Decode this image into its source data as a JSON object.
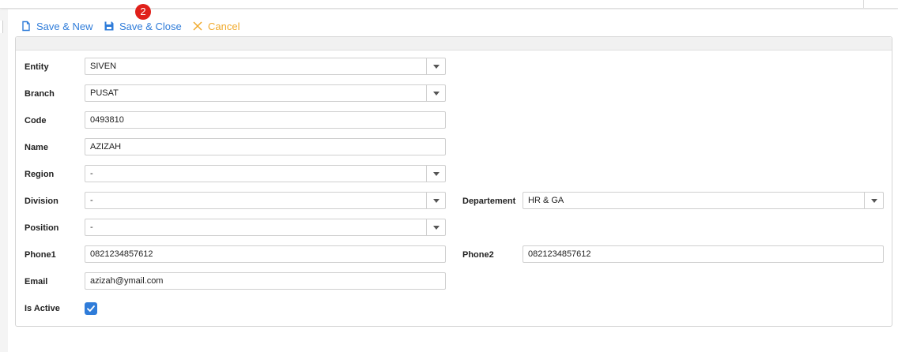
{
  "toolbar": {
    "save_new_label": "Save & New",
    "save_close_label": "Save & Close",
    "cancel_label": "Cancel",
    "badge_count": "2"
  },
  "form": {
    "entity": {
      "label": "Entity",
      "value": "SIVEN"
    },
    "branch": {
      "label": "Branch",
      "value": "PUSAT"
    },
    "code": {
      "label": "Code",
      "value": "0493810"
    },
    "name": {
      "label": "Name",
      "value": "AZIZAH"
    },
    "region": {
      "label": "Region",
      "value": "-"
    },
    "division": {
      "label": "Division",
      "value": "-"
    },
    "departement": {
      "label": "Departement",
      "value": "HR & GA"
    },
    "position": {
      "label": "Position",
      "value": "-"
    },
    "phone1": {
      "label": "Phone1",
      "value": "0821234857612"
    },
    "phone2": {
      "label": "Phone2",
      "value": "0821234857612"
    },
    "email": {
      "label": "Email",
      "value": "azizah@ymail.com"
    },
    "is_active": {
      "label": "Is Active",
      "checked": true
    }
  },
  "colors": {
    "accent": "#2f7cd9",
    "cancel": "#f0a92b",
    "badge": "#e0201a"
  },
  "icons": {
    "save_new": "new-document-icon",
    "save_close": "floppy-disk-icon",
    "cancel": "x-icon",
    "dropdown": "caret-down-icon",
    "check": "checkmark-icon"
  }
}
